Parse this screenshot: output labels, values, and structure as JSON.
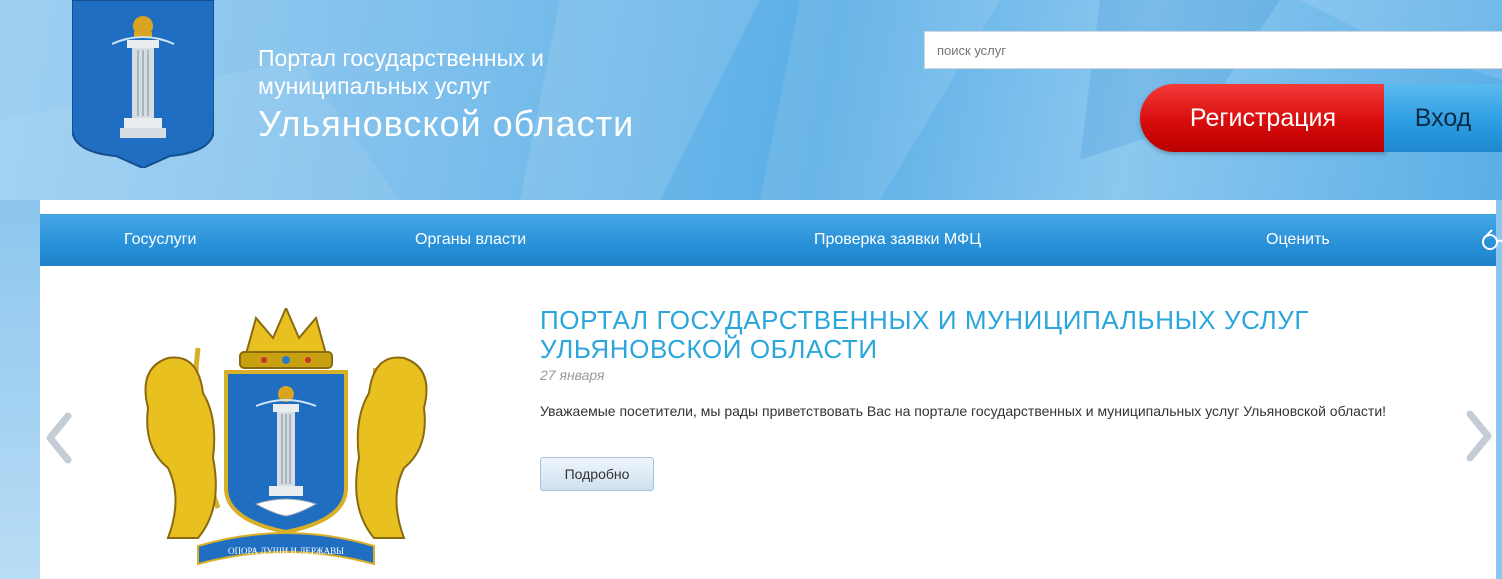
{
  "header": {
    "title_line1": "Портал государственных и",
    "title_line2": "муниципальных услуг",
    "title_line3": "Ульяновской области",
    "search_placeholder": "поиск услуг",
    "register_label": "Регистрация",
    "login_label": "Вход"
  },
  "nav": {
    "items": [
      {
        "label": "Госуслуги"
      },
      {
        "label": "Органы власти"
      },
      {
        "label": "Проверка заявки МФЦ"
      },
      {
        "label": "Оценить"
      }
    ],
    "accessibility_icon": "glasses-icon"
  },
  "slide": {
    "headline": "ПОРТАЛ ГОСУДАРСТВЕННЫХ И МУНИЦИПАЛЬНЫХ УСЛУГ УЛЬЯНОВСКОЙ ОБЛАСТИ",
    "date": "27 января",
    "text": "Уважаемые посетители, мы рады приветствовать Вас на портале государственных и муниципальных услуг Ульяновской области!",
    "button_label": "Подробно",
    "emblem_motto": "ОПОРА ДУШИ И ДЕРЖАВЫ"
  },
  "colors": {
    "header_blue": "#5aaee6",
    "nav_blue": "#2790d8",
    "register_red": "#d80c0c",
    "login_blue": "#2a9be0",
    "headline_blue": "#2aa6dc",
    "emblem_gold": "#e8c020"
  },
  "icons": [
    "shield-logo-icon",
    "glasses-icon",
    "chevron-left-icon",
    "chevron-right-icon",
    "coat-of-arms-icon"
  ]
}
